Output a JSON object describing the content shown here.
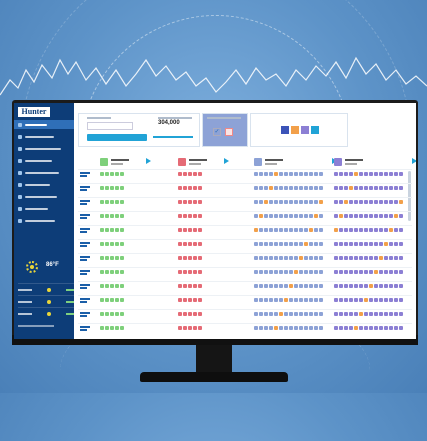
{
  "brand": {
    "logo_text": "Hunter"
  },
  "sidebar": {
    "items": [
      {
        "icon": "dashboard-icon",
        "active": true
      },
      {
        "icon": "clock-icon",
        "active": false
      },
      {
        "icon": "sprinkler-icon",
        "active": false
      },
      {
        "icon": "flow-icon",
        "active": false
      },
      {
        "icon": "chart-icon",
        "active": false
      },
      {
        "icon": "gear-icon",
        "active": false
      },
      {
        "icon": "report-icon",
        "active": false
      },
      {
        "icon": "map-icon",
        "active": false
      },
      {
        "icon": "user-icon",
        "active": false
      }
    ]
  },
  "weather": {
    "temperature": "86°F",
    "icon": "sun-icon",
    "forecast_rows": 3
  },
  "topbar": {
    "total_value": "304,000",
    "checkbox_mark": "✓"
  },
  "grid": {
    "columns": [
      {
        "key": "c1",
        "color": "#7ed07b"
      },
      {
        "key": "c2",
        "color": "#e56b76"
      },
      {
        "key": "c3",
        "color": "#8da2d6"
      },
      {
        "key": "c4",
        "color": "#8c7fd4"
      }
    ],
    "rows": 12
  },
  "colors": {
    "sidebar": "#0d3d78",
    "accent": "#21a3d6",
    "active_nav": "#2f6fb8"
  }
}
